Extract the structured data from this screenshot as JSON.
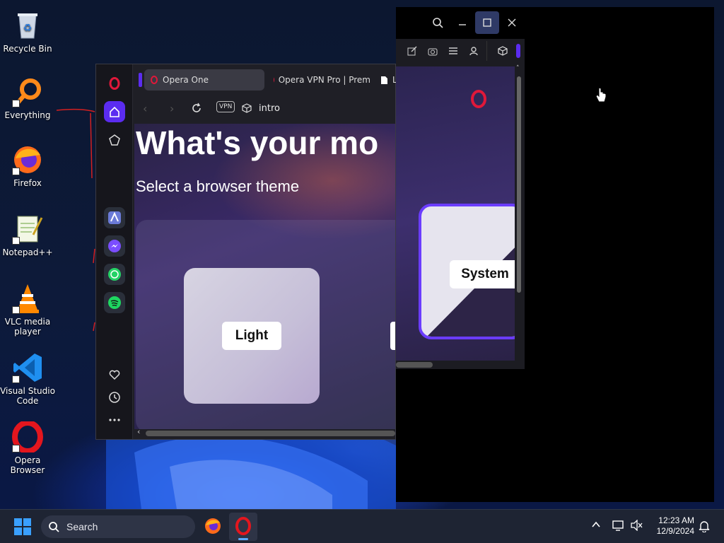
{
  "desktop": {
    "icons": [
      {
        "label": "Recycle Bin",
        "icon": "recycle-bin-icon"
      },
      {
        "label": "Everything",
        "icon": "everything-icon"
      },
      {
        "label": "Firefox",
        "icon": "firefox-icon"
      },
      {
        "label": "Notepad++",
        "icon": "notepadpp-icon"
      },
      {
        "label": "VLC media player",
        "icon": "vlc-icon"
      },
      {
        "label": "Visual Studio Code",
        "icon": "vscode-icon"
      },
      {
        "label": "Opera Browser",
        "icon": "opera-icon"
      }
    ]
  },
  "browser": {
    "tabs": [
      {
        "label": "Opera One",
        "active": true
      },
      {
        "label": "Opera VPN Pro | Prem",
        "active": false
      },
      {
        "label": "L",
        "active": false
      }
    ],
    "address": {
      "vpn_badge": "VPN",
      "url": "intro"
    },
    "page": {
      "headline": "What's your mo",
      "subheadline": "Select a browser theme",
      "themes": [
        {
          "label": "Light"
        },
        {
          "label": "System"
        }
      ]
    },
    "accent_color": "#5b2cf0",
    "brand_color": "#e0183a"
  },
  "taskbar": {
    "search_label": "Search",
    "time": "12:23 AM",
    "date": "12/9/2024"
  }
}
